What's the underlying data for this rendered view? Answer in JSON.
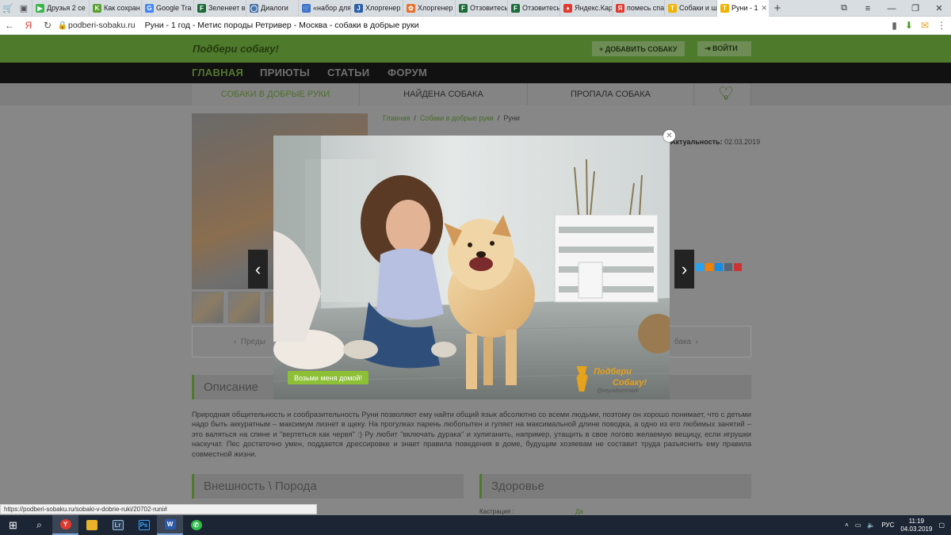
{
  "browser": {
    "tabs": [
      {
        "label": "Друзья 2 се",
        "color": "#3bb44a",
        "glyph": "▶"
      },
      {
        "label": "Как сохран",
        "color": "#5aa02c",
        "glyph": "K"
      },
      {
        "label": "Google Tra",
        "color": "#4285f4",
        "glyph": "G"
      },
      {
        "label": "Зеленеет в",
        "color": "#1e6b3a",
        "glyph": "F"
      },
      {
        "label": "Диалоги",
        "color": "#4a76a8",
        "glyph": "◯"
      },
      {
        "label": "«набор для",
        "color": "#3b6fd0",
        "glyph": "🛒"
      },
      {
        "label": "Хлоргенер",
        "color": "#2d5fa8",
        "glyph": "J"
      },
      {
        "label": "Хлоргенер",
        "color": "#e96f2a",
        "glyph": "✿"
      },
      {
        "label": "Отзовитесь",
        "color": "#1e6b3a",
        "glyph": "F"
      },
      {
        "label": "Отзовитесь",
        "color": "#1e6b3a",
        "glyph": "F"
      },
      {
        "label": "Яндекс.Кар",
        "color": "#e03a2f",
        "glyph": "♦"
      },
      {
        "label": "помесь спа",
        "color": "#e03a2f",
        "glyph": "Я"
      },
      {
        "label": "Собаки и щ",
        "color": "#f0b400",
        "glyph": "Т"
      },
      {
        "label": "Руни - 1",
        "color": "#f0b400",
        "glyph": "Т"
      }
    ],
    "active_tab_index": 13,
    "host": "podberi-sobaku.ru",
    "page_title": "Руни - 1 год - Метис породы Ретривер - Москва - собаки в добрые руки",
    "status_url": "https://podberi-sobaku.ru/sobaki-v-dobrie-ruki/20702-runi#"
  },
  "site": {
    "logo": "Подбери собаку!",
    "add_dog_button": "+ ДОБАВИТЬ СОБАКУ",
    "login_button": "⇥ ВОЙТИ",
    "menu": [
      "ГЛАВНАЯ",
      "ПРИЮТЫ",
      "СТАТЬИ",
      "ФОРУМ"
    ],
    "subnav": [
      "СОБАКИ В ДОБРЫЕ РУКИ",
      "НАЙДЕНА СОБАКА",
      "ПРОПАЛА СОБАКА"
    ],
    "favorites_count": "0"
  },
  "page": {
    "breadcrumbs": [
      "Главная",
      "/",
      "Собаки в добрые руки",
      "/",
      "Руни"
    ],
    "actuality_label": "Актуальность:",
    "actuality_date": "02.03.2019",
    "prev_label": "Преды",
    "next_label": "бака",
    "description_title": "Описание",
    "description_text": "Природная общительность и сообразительность Руни позволяют ему найти общий язык абсолютно со всеми людьми, поэтому он хорошо понимает, что с детьми надо быть аккуратным – максимум лизнет в щеку. На прогулках парень любопытен и гуляет на максимальной длине поводка, а одно из его любимых занятий – это валяться на спине и \"вертеться как червя\" :) Ру любит \"включать дурака\" и хулиганить, например, утащить в свое логово желаемую вещицу, если игрушки наскучат. Пес достаточно умен, поддается дрессировке и знает правила поведения в доме, будущим хозяевам не составит труда разъяснить ему правила совместной жизни.",
    "appearance_title": "Внешность \\ Порода",
    "health_title": "Здоровье",
    "castration_label": "Кастрация :",
    "castration_value": "Да"
  },
  "lightbox": {
    "badge": "Возьми меня домой!",
    "watermark_line1": "Подбери",
    "watermark_line2": "Собаку!",
    "watermark_line3": "@kepadsimmark"
  },
  "taskbar": {
    "language": "РУС",
    "time": "11:19",
    "date": "04.03.2019"
  }
}
